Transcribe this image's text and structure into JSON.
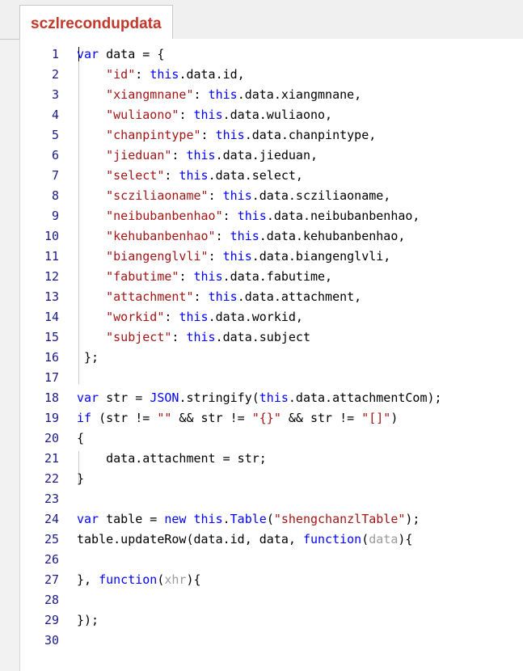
{
  "tab": {
    "label": "sczlrecondupdata"
  },
  "code_lines": [
    [
      [
        "kw",
        "var"
      ],
      [
        "ident",
        " data = {"
      ]
    ],
    [
      [
        "ident",
        "    "
      ],
      [
        "str",
        "\"id\""
      ],
      [
        "ident",
        ": "
      ],
      [
        "fn-this",
        "this"
      ],
      [
        "ident",
        ".data.id,"
      ]
    ],
    [
      [
        "ident",
        "    "
      ],
      [
        "str",
        "\"xiangmnane\""
      ],
      [
        "ident",
        ": "
      ],
      [
        "fn-this",
        "this"
      ],
      [
        "ident",
        ".data.xiangmnane,"
      ]
    ],
    [
      [
        "ident",
        "    "
      ],
      [
        "str",
        "\"wuliaono\""
      ],
      [
        "ident",
        ": "
      ],
      [
        "fn-this",
        "this"
      ],
      [
        "ident",
        ".data.wuliaono,"
      ]
    ],
    [
      [
        "ident",
        "    "
      ],
      [
        "str",
        "\"chanpintype\""
      ],
      [
        "ident",
        ": "
      ],
      [
        "fn-this",
        "this"
      ],
      [
        "ident",
        ".data.chanpintype,"
      ]
    ],
    [
      [
        "ident",
        "    "
      ],
      [
        "str",
        "\"jieduan\""
      ],
      [
        "ident",
        ": "
      ],
      [
        "fn-this",
        "this"
      ],
      [
        "ident",
        ".data.jieduan,"
      ]
    ],
    [
      [
        "ident",
        "    "
      ],
      [
        "str",
        "\"select\""
      ],
      [
        "ident",
        ": "
      ],
      [
        "fn-this",
        "this"
      ],
      [
        "ident",
        ".data.select,"
      ]
    ],
    [
      [
        "ident",
        "    "
      ],
      [
        "str",
        "\"scziliaoname\""
      ],
      [
        "ident",
        ": "
      ],
      [
        "fn-this",
        "this"
      ],
      [
        "ident",
        ".data.scziliaoname,"
      ]
    ],
    [
      [
        "ident",
        "    "
      ],
      [
        "str",
        "\"neibubanbenhao\""
      ],
      [
        "ident",
        ": "
      ],
      [
        "fn-this",
        "this"
      ],
      [
        "ident",
        ".data.neibubanbenhao,"
      ]
    ],
    [
      [
        "ident",
        "    "
      ],
      [
        "str",
        "\"kehubanbenhao\""
      ],
      [
        "ident",
        ": "
      ],
      [
        "fn-this",
        "this"
      ],
      [
        "ident",
        ".data.kehubanbenhao,"
      ]
    ],
    [
      [
        "ident",
        "    "
      ],
      [
        "str",
        "\"biangenglvli\""
      ],
      [
        "ident",
        ": "
      ],
      [
        "fn-this",
        "this"
      ],
      [
        "ident",
        ".data.biangenglvli,"
      ]
    ],
    [
      [
        "ident",
        "    "
      ],
      [
        "str",
        "\"fabutime\""
      ],
      [
        "ident",
        ": "
      ],
      [
        "fn-this",
        "this"
      ],
      [
        "ident",
        ".data.fabutime,"
      ]
    ],
    [
      [
        "ident",
        "    "
      ],
      [
        "str",
        "\"attachment\""
      ],
      [
        "ident",
        ": "
      ],
      [
        "fn-this",
        "this"
      ],
      [
        "ident",
        ".data.attachment,"
      ]
    ],
    [
      [
        "ident",
        "    "
      ],
      [
        "str",
        "\"workid\""
      ],
      [
        "ident",
        ": "
      ],
      [
        "fn-this",
        "this"
      ],
      [
        "ident",
        ".data.workid,"
      ]
    ],
    [
      [
        "ident",
        "    "
      ],
      [
        "str",
        "\"subject\""
      ],
      [
        "ident",
        ": "
      ],
      [
        "fn-this",
        "this"
      ],
      [
        "ident",
        ".data.subject"
      ]
    ],
    [
      [
        "ident",
        " };"
      ]
    ],
    [],
    [
      [
        "kw",
        "var"
      ],
      [
        "ident",
        " str = "
      ],
      [
        "kw",
        "JSON"
      ],
      [
        "ident",
        ".stringify("
      ],
      [
        "fn-this",
        "this"
      ],
      [
        "ident",
        ".data.attachmentCom);"
      ]
    ],
    [
      [
        "kw",
        "if"
      ],
      [
        "ident",
        " (str != "
      ],
      [
        "str",
        "\"\""
      ],
      [
        "ident",
        " && str != "
      ],
      [
        "str",
        "\"{}\""
      ],
      [
        "ident",
        " && str != "
      ],
      [
        "str",
        "\"[]\""
      ],
      [
        "ident",
        ")"
      ]
    ],
    [
      [
        "ident",
        "{"
      ]
    ],
    [
      [
        "ident",
        "    data.attachment = str;"
      ]
    ],
    [
      [
        "ident",
        "}"
      ]
    ],
    [],
    [
      [
        "kw",
        "var"
      ],
      [
        "ident",
        " table = "
      ],
      [
        "kw",
        "new"
      ],
      [
        "ident",
        " "
      ],
      [
        "fn-this",
        "this"
      ],
      [
        "ident",
        "."
      ],
      [
        "kw",
        "Table"
      ],
      [
        "ident",
        "("
      ],
      [
        "str",
        "\"shengchanzlTable\""
      ],
      [
        "ident",
        ");"
      ]
    ],
    [
      [
        "ident",
        "table.updateRow(data.id, data, "
      ],
      [
        "kw",
        "function"
      ],
      [
        "ident",
        "("
      ],
      [
        "param",
        "data"
      ],
      [
        "ident",
        "){"
      ]
    ],
    [],
    [
      [
        "ident",
        "}, "
      ],
      [
        "kw",
        "function"
      ],
      [
        "ident",
        "("
      ],
      [
        "param",
        "xhr"
      ],
      [
        "ident",
        "){"
      ]
    ],
    [],
    [
      [
        "ident",
        "});"
      ]
    ],
    []
  ]
}
